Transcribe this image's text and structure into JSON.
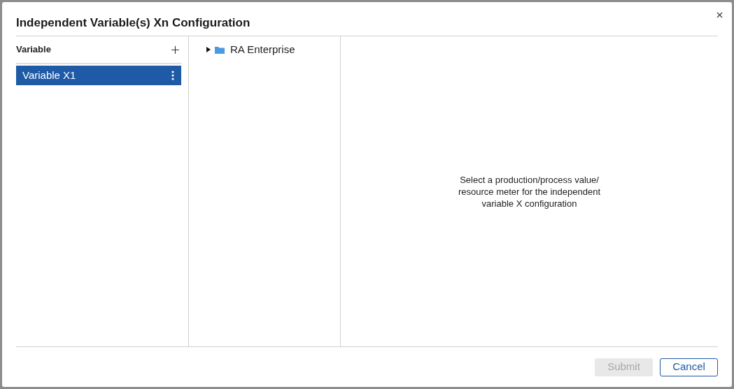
{
  "dialog": {
    "title": "Independent Variable(s) Xn Configuration"
  },
  "variables": {
    "heading": "Variable",
    "items": [
      {
        "label": "Variable X1",
        "selected": true
      }
    ]
  },
  "tree": [
    {
      "label": "RA Enterprise",
      "expanded": false
    }
  ],
  "message": "Select a production/process value/ resource meter for the independent variable X configuration",
  "buttons": [
    {
      "label": "Submit",
      "kind": "primary",
      "disabled": true
    },
    {
      "label": "Cancel",
      "kind": "secondary",
      "disabled": false
    }
  ]
}
